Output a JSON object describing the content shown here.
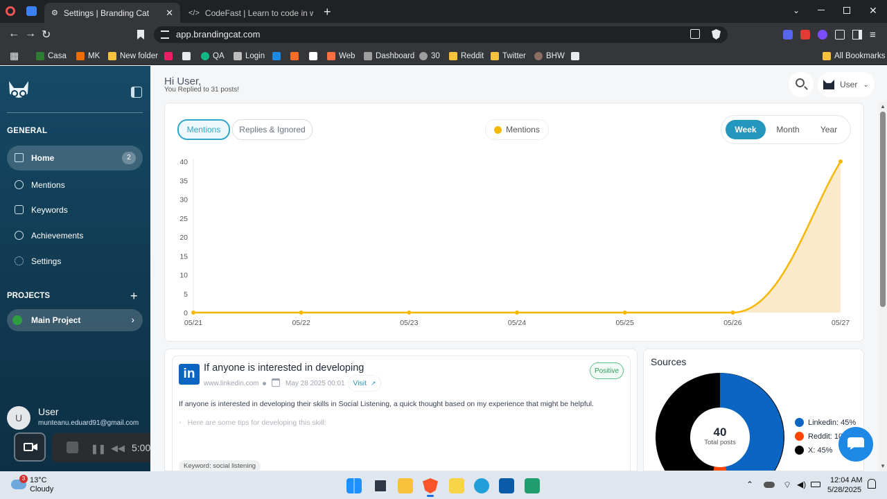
{
  "browser": {
    "tabs": [
      {
        "label": "Settings | Branding Cat"
      },
      {
        "label": "CodeFast | Learn to code in weeks, n"
      }
    ],
    "url": "app.brandingcat.com",
    "bookmarks": [
      "Casa",
      "MK",
      "New folder",
      "QA",
      "Login",
      "Web",
      "Dashboard",
      "30",
      "Reddit",
      "Twitter",
      "BHW"
    ],
    "all_bookmarks": "All Bookmarks"
  },
  "sidebar": {
    "general_heading": "GENERAL",
    "items": [
      {
        "label": "Home",
        "badge": "2"
      },
      {
        "label": "Mentions"
      },
      {
        "label": "Keywords"
      },
      {
        "label": "Achievements"
      },
      {
        "label": "Settings"
      }
    ],
    "projects_heading": "PROJECTS",
    "project": "Main Project",
    "user": {
      "initial": "U",
      "name": "User",
      "email": "munteanu.eduard91@gmail.com"
    }
  },
  "recorder": {
    "time": "5:00"
  },
  "header": {
    "greeting": "Hi User,",
    "subtitle": "You Replied to 31 posts!",
    "user_label": "User"
  },
  "chart_tabs": {
    "mentions": "Mentions",
    "replies": "Replies & Ignored"
  },
  "range": {
    "week": "Week",
    "month": "Month",
    "year": "Year"
  },
  "chart_data": {
    "type": "area",
    "series": [
      {
        "name": "Mentions",
        "values": [
          0,
          0,
          0,
          0,
          0,
          0,
          40
        ]
      }
    ],
    "categories": [
      "05/21",
      "05/22",
      "05/23",
      "05/24",
      "05/25",
      "05/26",
      "05/27"
    ],
    "yticks": [
      "0",
      "5",
      "10",
      "15",
      "20",
      "25",
      "30",
      "35",
      "40"
    ],
    "ylim": [
      0,
      40
    ],
    "color": "#f5b800",
    "legend": "top-center"
  },
  "post": {
    "title": "If anyone is interested in developing",
    "sentiment": "Positive",
    "domain": "www.linkedin.com",
    "date": "May 28 2025 00:01",
    "visit": "Visit",
    "body": "If anyone is interested in developing their skills in Social Listening, a quick thought based on my experience that might be helpful.",
    "tip": "Here are some tips for developing this skill:",
    "keyword": "Keyword: social listening"
  },
  "sources": {
    "title": "Sources",
    "total": "40",
    "total_label": "Total posts",
    "legend": [
      {
        "label": "Linkedin: 45%",
        "color": "#0a66c2"
      },
      {
        "label": "Reddit: 10",
        "color": "#ff4500"
      },
      {
        "label": "X: 45%",
        "color": "#000000"
      }
    ]
  },
  "taskbar": {
    "weather_temp": "13°C",
    "weather_desc": "Cloudy",
    "weather_badge": "3",
    "time": "12:04 AM",
    "date": "5/28/2025"
  }
}
